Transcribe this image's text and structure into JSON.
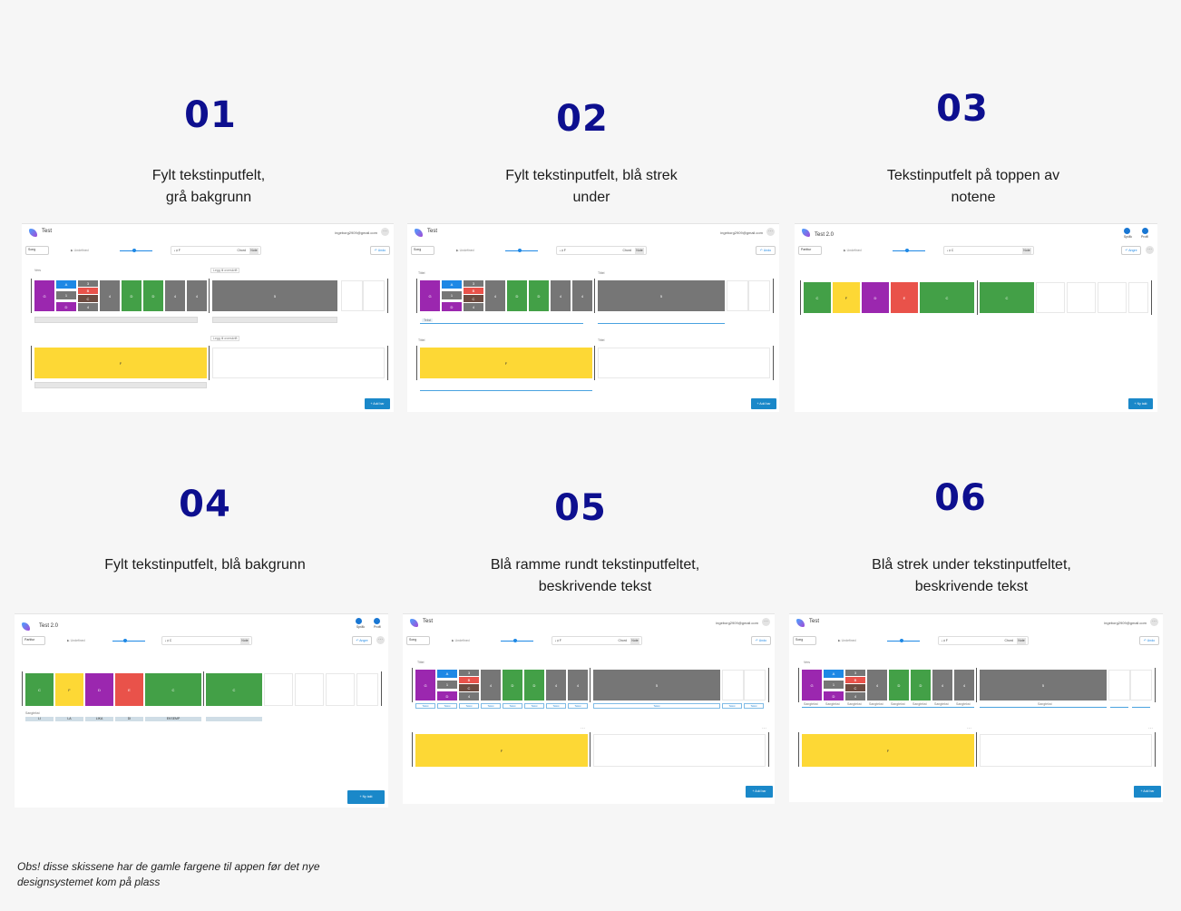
{
  "steps": [
    {
      "number": "01",
      "title_line1": "Fylt tekstinputfelt,",
      "title_line2": "grå bakgrunn"
    },
    {
      "number": "02",
      "title_line1": "Fylt tekstinputfelt, blå strek",
      "title_line2": "under"
    },
    {
      "number": "03",
      "title_line1": "Tekstinputfelt på toppen av",
      "title_line2": "notene"
    },
    {
      "number": "04",
      "title_line1": "Fylt tekstinputfelt, blå bakgrunn",
      "title_line2": ""
    },
    {
      "number": "05",
      "title_line1": "Blå ramme rundt tekstinputfeltet,",
      "title_line2": "beskrivende tekst"
    },
    {
      "number": "06",
      "title_line1": "Blå strek under tekstinputfeltet,",
      "title_line2": "beskrivende tekst"
    }
  ],
  "mock": {
    "title_a": "Test",
    "title_b": "Test 2.0",
    "email": "ingeborg2909@gmail.com",
    "select_a": "Song",
    "select_b": "Partitur",
    "play": "Undefined",
    "chord": "Chord",
    "note": "Note",
    "undo": "Undo",
    "angre": "Angre",
    "add_bar": "Add bar",
    "ny_takt": "Ny takt",
    "legg_til": "Legg til overskrift",
    "vers": "Vers",
    "tittel": "Tittel",
    "tekst": "Tekst",
    "songtekst": "Sangtekst",
    "sprak": "Språk",
    "profil": "Profil",
    "lyrics": [
      "LI",
      "LA",
      "LIKA",
      "DI",
      "EKSEMP"
    ],
    "block_labels": [
      "G",
      "A",
      "B",
      "C",
      "D",
      "E",
      "F",
      "4",
      "5",
      "1",
      "2",
      "3"
    ]
  },
  "colors": {
    "purple": "#9b27af",
    "blue": "#1e88e5",
    "grey": "#767676",
    "red": "#e9524a",
    "green": "#43a047",
    "yellow": "#fdd835",
    "brown": "#6d4c41",
    "accent": "#1a88c9",
    "heading": "#0d0f8f"
  },
  "footnote": "Obs! disse skissene har de gamle fargene til appen før det nye designsystemet kom på plass"
}
